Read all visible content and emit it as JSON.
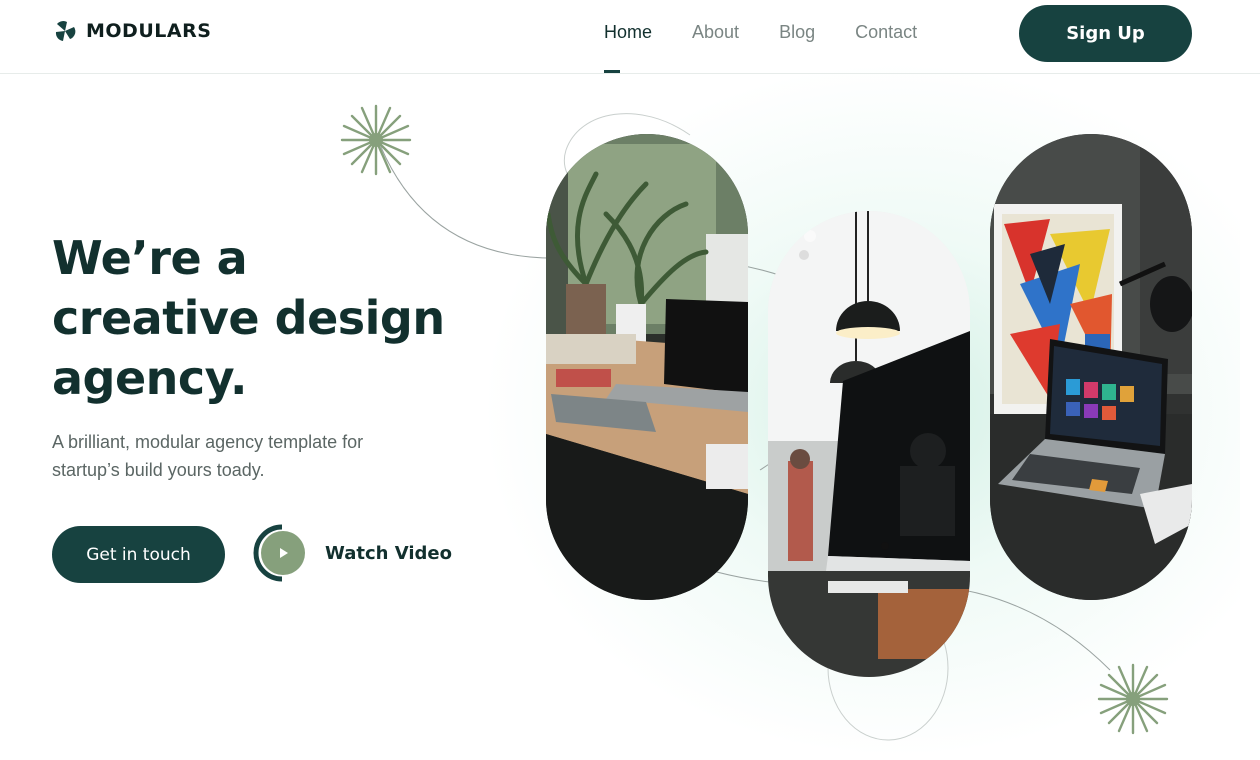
{
  "brand": {
    "name": "MODULARS",
    "logo_icon": "trefoil-logo-icon"
  },
  "nav": {
    "items": [
      {
        "label": "Home",
        "active": true
      },
      {
        "label": "About",
        "active": false
      },
      {
        "label": "Blog",
        "active": false
      },
      {
        "label": "Contact",
        "active": false
      }
    ],
    "signup_label": "Sign Up"
  },
  "hero": {
    "title_lines": [
      "We’re a",
      "creative design",
      "agency."
    ],
    "subtitle": "A brilliant, modular agency template for startup’s build yours toady.",
    "cta_label": "Get in touch",
    "video_label": "Watch Video",
    "video_icon": "play-icon"
  },
  "images": [
    {
      "name": "workspace-plants-photo",
      "description_icon": "photo"
    },
    {
      "name": "imac-pendant-lamp-photo",
      "description_icon": "photo"
    },
    {
      "name": "laptop-artwork-photo",
      "description_icon": "photo"
    }
  ],
  "colors": {
    "primary": "#174240",
    "heading": "#12302e",
    "accent_green": "#86a07c",
    "muted_text": "#5b6664",
    "nav_inactive": "#7a8583",
    "glow": "#c4ebdc"
  }
}
